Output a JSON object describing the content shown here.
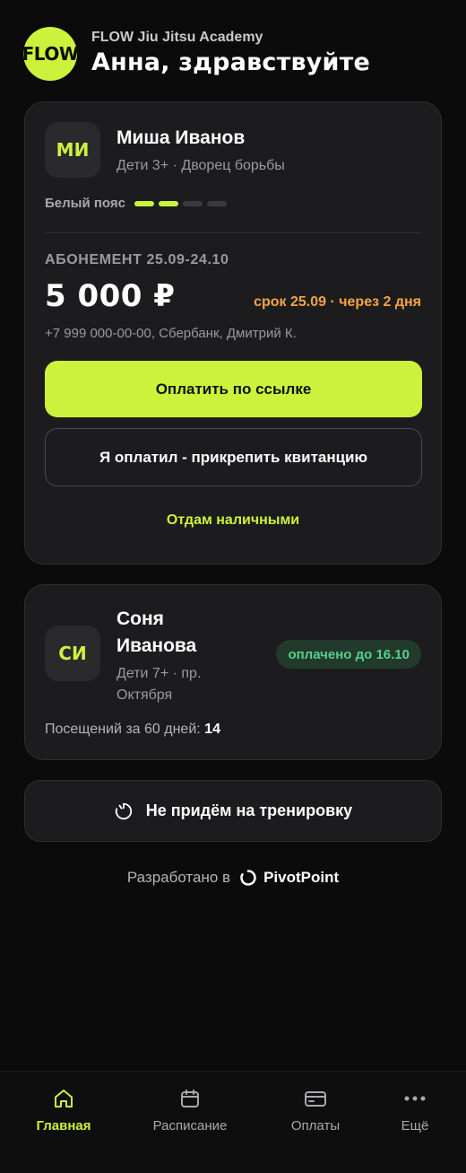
{
  "header": {
    "logo_text": "FLOW",
    "academy": "FLOW Jiu Jitsu Academy",
    "greeting": "Анна, здравствуйте"
  },
  "students": [
    {
      "initials": "МИ",
      "name": "Миша Иванов",
      "group": "Дети 3+ · Дворец борьбы",
      "belt": "Белый пояс",
      "belt_stripes_filled": 2,
      "belt_stripes_total": 4,
      "subscription_title": "АБОНЕМЕНТ 25.09-24.10",
      "amount": "5 000 ₽",
      "due": "срок 25.09 · через 2 дня",
      "requisites": "+7 999 000-00-00, Сбербанк, Дмитрий К.",
      "pay_button": "Оплатить по ссылке",
      "receipt_button": "Я оплатил - прикрепить квитанцию",
      "cash_link": "Отдам наличными"
    },
    {
      "initials": "СИ",
      "name_line1": "Соня",
      "name_line2": "Иванова",
      "group_line1": "Дети 7+ · пр.",
      "group_line2": "Октября",
      "status_badge": "оплачено до 16.10",
      "visits_label": "Посещений за 60 дней:",
      "visits_count": "14"
    }
  ],
  "skip_button": "Не придём на тренировку",
  "footer": {
    "developed_by": "Разработано в",
    "brand": "PivotPoint"
  },
  "tabbar": {
    "home": "Главная",
    "schedule": "Расписание",
    "payments": "Оплаты",
    "more": "Ещё"
  },
  "colors": {
    "accent": "#ccf23b",
    "background": "#0b0b0b",
    "card": "#1c1c1e",
    "warning": "#f5a443",
    "success": "#57d08a"
  }
}
